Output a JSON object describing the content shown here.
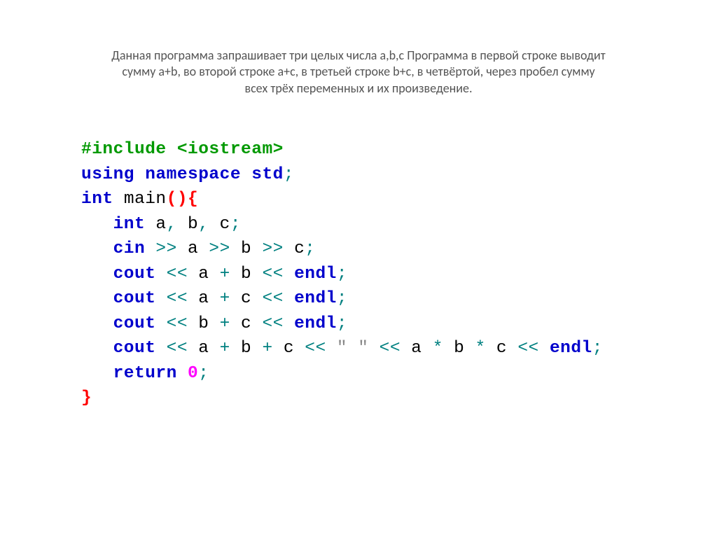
{
  "title_line1": "Данная программа запрашивает три целых числа a,b,c  Программа в первой строке выводит",
  "title_line2": "сумму a+b, во второй строке a+c, в третьей строке b+c, в четвёртой, через пробел сумму",
  "title_line3": "всех трёх переменных и их произведение.",
  "code": {
    "l1_include": "#include",
    "l1_iostream": " <iostream>",
    "l2_using": "using",
    "l2_namespace": "namespace",
    "l2_std": "std",
    "l2_semi": ";",
    "l3_int": "int",
    "l3_main": "main",
    "l3_parens": "()",
    "l3_brace": "{",
    "l4_int": "int",
    "l4_a": "a",
    "l4_c1": ",",
    "l4_b": " b",
    "l4_c2": ",",
    "l4_c": " c",
    "l4_semi": ";",
    "l5_cin": "cin",
    "l5_gg1": " >> ",
    "l5_a": "a",
    "l5_gg2": " >> ",
    "l5_b": "b",
    "l5_gg3": " >> ",
    "l5_c": "c",
    "l5_semi": ";",
    "l6_cout": "cout",
    "l6_ll1": " << ",
    "l6_a": "a",
    "l6_plus": " + ",
    "l6_b": "b",
    "l6_ll2": " << ",
    "l6_endl": "endl",
    "l6_semi": ";",
    "l7_cout": "cout",
    "l7_ll1": " << ",
    "l7_a": "a",
    "l7_plus": " + ",
    "l7_c": "c",
    "l7_ll2": " << ",
    "l7_endl": "endl",
    "l7_semi": ";",
    "l8_cout": "cout",
    "l8_ll1": " << ",
    "l8_b": "b",
    "l8_plus": " + ",
    "l8_c": "c",
    "l8_ll2": " << ",
    "l8_endl": "endl",
    "l8_semi": ";",
    "l9_cout": "cout",
    "l9_ll1": " << ",
    "l9_a": "a",
    "l9_p1": " + ",
    "l9_b": "b",
    "l9_p2": " + ",
    "l9_c": "c",
    "l9_ll2": " << ",
    "l9_str": "\" \"",
    "l9_ll3": " << ",
    "l9_a2": "a",
    "l9_m1": " * ",
    "l9_b2": "b",
    "l9_m2": " * ",
    "l9_c2": "c",
    "l9_ll4": " << ",
    "l9_endl": "endl",
    "l9_semi": ";",
    "l10_return": "return",
    "l10_sp": " ",
    "l10_zero": "0",
    "l10_semi": ";",
    "l11_brace": "}"
  }
}
